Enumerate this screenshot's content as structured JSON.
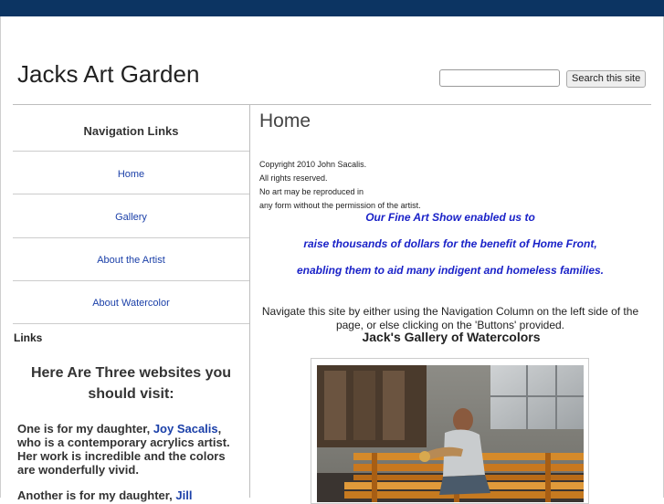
{
  "header": {
    "site_title": "Jacks Art Garden",
    "search_placeholder": "",
    "search_button": "Search this site"
  },
  "sidebar": {
    "nav_heading": "Navigation Links",
    "items": [
      {
        "label": "Home"
      },
      {
        "label": "Gallery"
      },
      {
        "label": "About the Artist"
      },
      {
        "label": "About Watercolor"
      }
    ],
    "links_label": "Links",
    "three_sites": "Here Are Three websites you should visit:",
    "daughter1_pre": "One is for my daughter, ",
    "daughter1_link": "Joy Sacalis",
    "daughter1_post": ", who is a contemporary acrylics artist. Her work is incredible and the colors are wonderfully vivid.",
    "daughter2_pre": "Another is for my daughter, ",
    "daughter2_link": "Jill"
  },
  "main": {
    "heading": "Home",
    "copyright": [
      "Copyright 2010 John Sacalis.",
      "All rights reserved.",
      "No art may be reproduced in",
      "any form without the permission of the artist."
    ],
    "show_lines": [
      "Our Fine Art Show enabled us to",
      "raise thousands of dollars for the benefit of Home Front,",
      "enabling them to aid many indigent and homeless families."
    ],
    "navigate_text": "Navigate this site by either using the Navigation Column on the left side of the page, or else clicking on the 'Buttons' provided.",
    "gallery_title": "Jack's Gallery of Watercolors"
  },
  "colors": {
    "top_bar": "#0c3462",
    "link": "#1a3fa8",
    "show_text": "#1a22c8"
  }
}
